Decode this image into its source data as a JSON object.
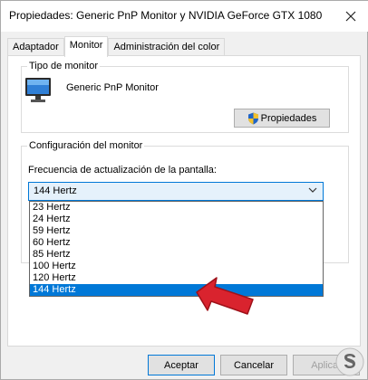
{
  "window": {
    "title": "Propiedades: Generic PnP Monitor y NVIDIA GeForce GTX 1080"
  },
  "tabs": [
    {
      "label": "Adaptador",
      "active": false
    },
    {
      "label": "Monitor",
      "active": true
    },
    {
      "label": "Administración del color",
      "active": false
    }
  ],
  "monitor_type": {
    "group_label": "Tipo de monitor",
    "monitor_name": "Generic PnP Monitor",
    "icon": "monitor-icon",
    "properties_button": "Propiedades"
  },
  "monitor_config": {
    "group_label": "Configuración del monitor",
    "refresh_label": "Frecuencia de actualización de la pantalla:",
    "selected_value": "144 Hertz",
    "options": [
      "23 Hertz",
      "24 Hertz",
      "59 Hertz",
      "60 Hertz",
      "85 Hertz",
      "100 Hertz",
      "120 Hertz",
      "144 Hertz"
    ],
    "highlighted_option": "144 Hertz"
  },
  "footer": {
    "accept": "Aceptar",
    "cancel": "Cancelar",
    "apply": "Aplicar"
  },
  "colors": {
    "accent": "#0078d7",
    "arrow": "#d9232e"
  }
}
